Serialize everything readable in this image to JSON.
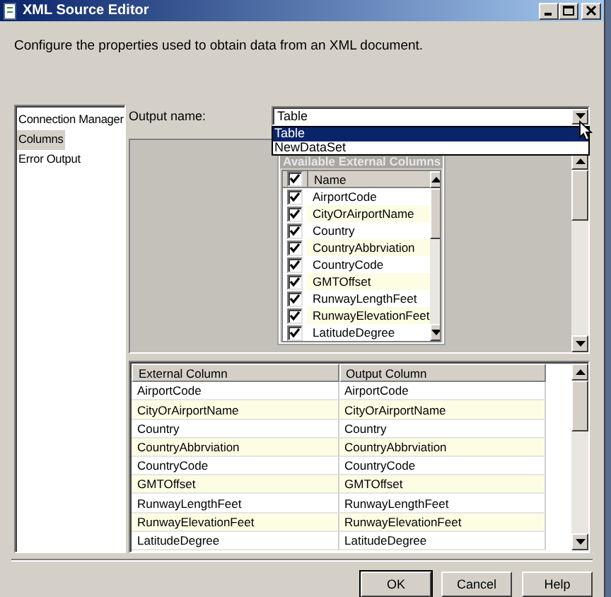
{
  "window": {
    "title": "XML Source Editor"
  },
  "description": "Configure the properties used to obtain data from an XML document.",
  "nav": [
    {
      "label": "Connection Manager",
      "selected": false
    },
    {
      "label": "Columns",
      "selected": true
    },
    {
      "label": "Error Output",
      "selected": false
    }
  ],
  "output_name": {
    "label": "Output name:",
    "value": "Table",
    "expanded": true,
    "options": [
      {
        "label": "Table",
        "selected": true
      },
      {
        "label": "NewDataSet",
        "selected": false
      }
    ]
  },
  "available_columns": {
    "title": "Available External Columns",
    "all_checked": true,
    "header": "Name",
    "rows": [
      {
        "name": "AirportCode",
        "checked": true
      },
      {
        "name": "CityOrAirportName",
        "checked": true
      },
      {
        "name": "Country",
        "checked": true
      },
      {
        "name": "CountryAbbrviation",
        "checked": true
      },
      {
        "name": "CountryCode",
        "checked": true
      },
      {
        "name": "GMTOffset",
        "checked": true
      },
      {
        "name": "RunwayLengthFeet",
        "checked": true
      },
      {
        "name": "RunwayElevationFeet",
        "checked": true
      },
      {
        "name": "LatitudeDegree",
        "checked": true
      }
    ]
  },
  "mapping": {
    "columns": [
      "External Column",
      "Output Column"
    ],
    "rows": [
      [
        "AirportCode",
        "AirportCode"
      ],
      [
        "CityOrAirportName",
        "CityOrAirportName"
      ],
      [
        "Country",
        "Country"
      ],
      [
        "CountryAbbrviation",
        "CountryAbbrviation"
      ],
      [
        "CountryCode",
        "CountryCode"
      ],
      [
        "GMTOffset",
        "GMTOffset"
      ],
      [
        "RunwayLengthFeet",
        "RunwayLengthFeet"
      ],
      [
        "RunwayElevationFeet",
        "RunwayElevationFeet"
      ],
      [
        "LatitudeDegree",
        "LatitudeDegree"
      ]
    ]
  },
  "buttons": [
    {
      "label": "OK",
      "default": true
    },
    {
      "label": "Cancel",
      "default": false
    },
    {
      "label": "Help",
      "default": false
    }
  ]
}
